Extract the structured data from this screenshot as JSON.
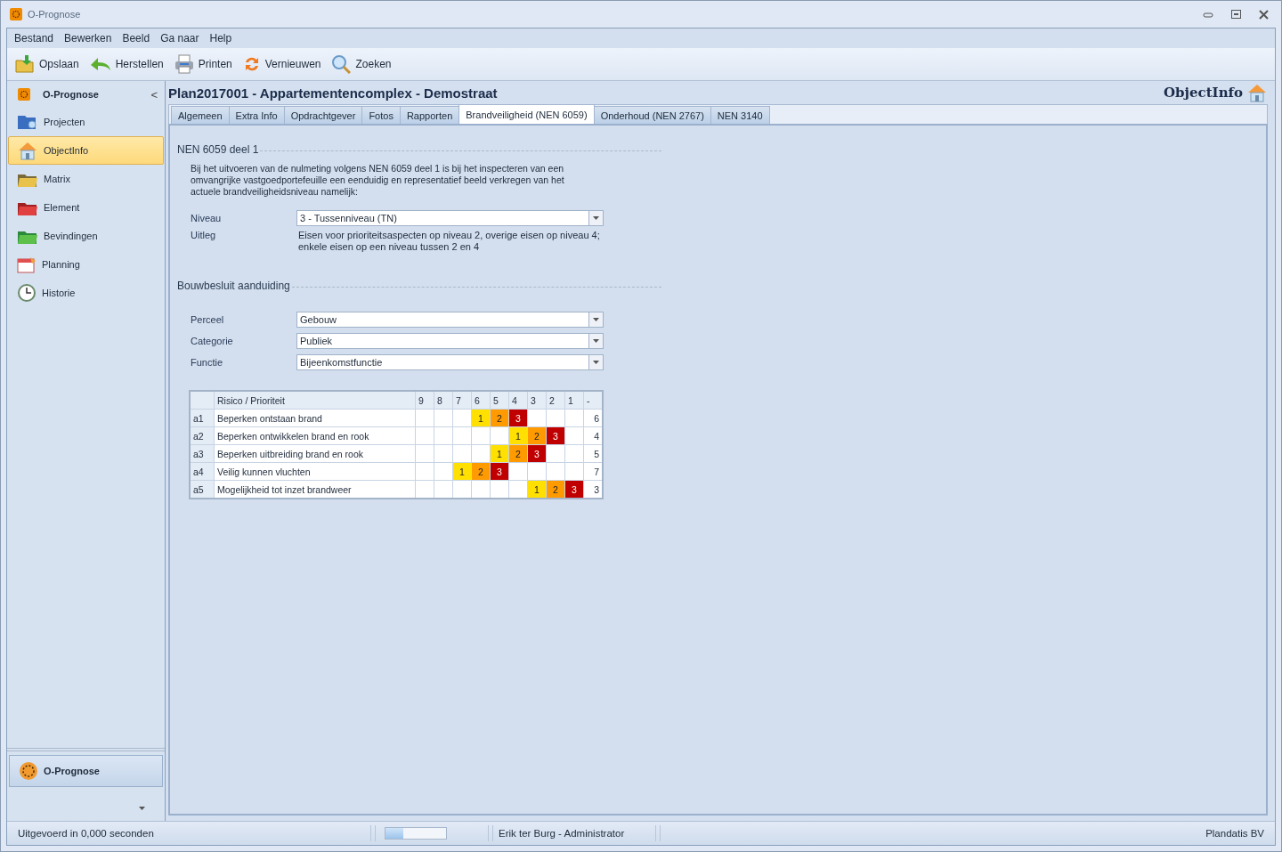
{
  "window": {
    "title": "O-Prognose"
  },
  "menu": [
    "Bestand",
    "Bewerken",
    "Beeld",
    "Ga naar",
    "Help"
  ],
  "toolbar": [
    {
      "kind": "save",
      "label": "Opslaan"
    },
    {
      "kind": "undo",
      "label": "Herstellen"
    },
    {
      "kind": "print",
      "label": "Printen"
    },
    {
      "kind": "refresh",
      "label": "Vernieuwen"
    },
    {
      "kind": "search",
      "label": "Zoeken"
    }
  ],
  "sidebar": {
    "title": "O-Prognose",
    "collapse": "<",
    "items": [
      {
        "label": "Projecten",
        "selected": false
      },
      {
        "label": "ObjectInfo",
        "selected": true
      },
      {
        "label": "Matrix",
        "selected": false
      },
      {
        "label": "Element",
        "selected": false
      },
      {
        "label": "Bevindingen",
        "selected": false
      },
      {
        "label": "Planning",
        "selected": false
      },
      {
        "label": "Historie",
        "selected": false
      }
    ],
    "footer_button": "O-Prognose"
  },
  "header": {
    "title": "Plan2017001 - Appartementencomplex - Demostraat",
    "section": "ObjectInfo"
  },
  "tabs": [
    {
      "label": "Algemeen",
      "selected": false
    },
    {
      "label": "Extra Info",
      "selected": false
    },
    {
      "label": "Opdrachtgever",
      "selected": false
    },
    {
      "label": "Fotos",
      "selected": false
    },
    {
      "label": "Rapporten",
      "selected": false
    },
    {
      "label": "Brandveiligheid (NEN 6059)",
      "selected": true
    },
    {
      "label": "Onderhoud (NEN 2767)",
      "selected": false
    },
    {
      "label": "NEN 3140",
      "selected": false
    }
  ],
  "nen_section": {
    "title": "NEN 6059 deel 1",
    "intro": "Bij het uitvoeren van de nulmeting volgens NEN 6059 deel 1 is bij het inspecteren van een omvangrijke vastgoedportefeuille een eenduidig en representatief beeld verkregen van het actuele brandveiligheidsniveau namelijk:",
    "niveau_label": "Niveau",
    "niveau_value": "3 - Tussenniveau (TN)",
    "uitleg_label": "Uitleg",
    "uitleg_text": "Eisen voor prioriteitsaspecten op niveau 2, overige eisen op niveau 4; enkele eisen op een niveau tussen 2 en 4"
  },
  "bouwbesluit": {
    "title": "Bouwbesluit aanduiding",
    "fields": [
      {
        "label": "Perceel",
        "value": "Gebouw"
      },
      {
        "label": "Categorie",
        "value": "Publiek"
      },
      {
        "label": "Functie",
        "value": "Bijeenkomstfunctie"
      }
    ]
  },
  "matrix": {
    "columns": [
      "",
      "Risico / Prioriteit",
      "9",
      "8",
      "7",
      "6",
      "5",
      "4",
      "3",
      "2",
      "1",
      "-"
    ],
    "rows": [
      {
        "cells": [
          "a1",
          "Beperken ontstaan brand",
          "",
          "",
          "",
          {
            "text": "1",
            "color": "#ffe000"
          },
          {
            "text": "2",
            "color": "#ff9a00"
          },
          {
            "text": "3",
            "color": "#c00000"
          },
          "",
          "",
          "",
          "6"
        ]
      },
      {
        "cells": [
          "a2",
          "Beperken ontwikkelen brand en rook",
          "",
          "",
          "",
          "",
          "",
          {
            "text": "1",
            "color": "#ffe000"
          },
          {
            "text": "2",
            "color": "#ff9a00"
          },
          {
            "text": "3",
            "color": "#c00000"
          },
          "",
          "4"
        ]
      },
      {
        "cells": [
          "a3",
          "Beperken uitbreiding brand en rook",
          "",
          "",
          "",
          "",
          {
            "text": "1",
            "color": "#ffe000"
          },
          {
            "text": "2",
            "color": "#ff9a00"
          },
          {
            "text": "3",
            "color": "#c00000"
          },
          "",
          "",
          "5"
        ]
      },
      {
        "cells": [
          "a4",
          "Veilig kunnen vluchten",
          "",
          "",
          {
            "text": "1",
            "color": "#ffe000"
          },
          {
            "text": "2",
            "color": "#ff9a00"
          },
          {
            "text": "3",
            "color": "#c00000"
          },
          "",
          "",
          "",
          "",
          "7"
        ]
      },
      {
        "cells": [
          "a5",
          "Mogelijkheid tot inzet brandweer",
          "",
          "",
          "",
          "",
          "",
          "",
          {
            "text": "1",
            "color": "#ffe000"
          },
          {
            "text": "2",
            "color": "#ff9a00"
          },
          {
            "text": "3",
            "color": "#c00000"
          },
          "3"
        ]
      }
    ]
  },
  "status_bar": {
    "message": "Uitgevoerd in 0,000 seconden",
    "progress": {
      "level": 0.3
    },
    "user": "Erik ter Burg - Administrator",
    "company": "Plandatis BV"
  }
}
